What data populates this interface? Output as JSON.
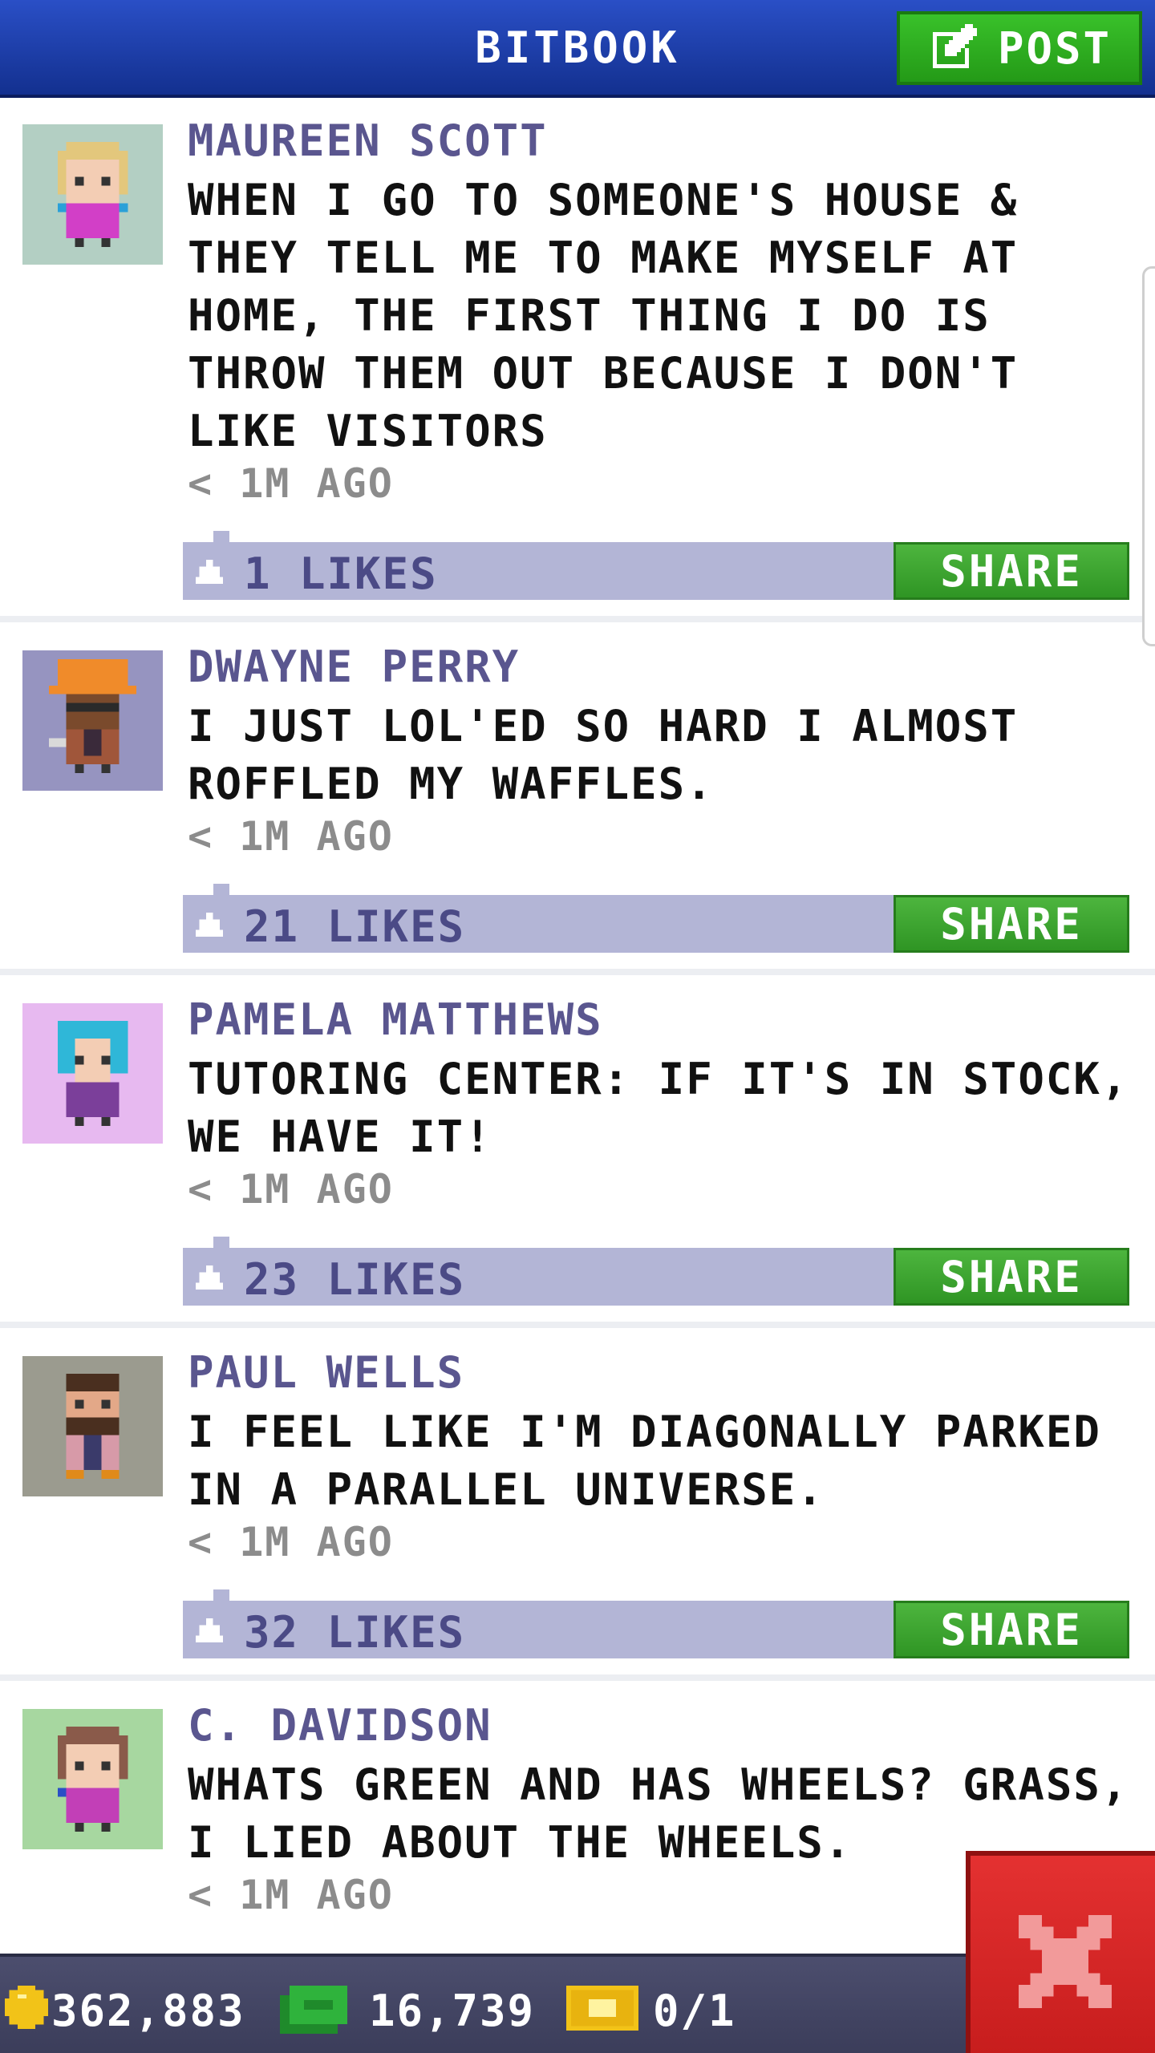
{
  "header": {
    "title": "BITBOOK",
    "post_label": "POST"
  },
  "colors": {
    "header_blue": "#1e3fb0",
    "action_green": "#2f9524",
    "likes_bar": "#b3b5d6",
    "author_purple": "#5a568f",
    "close_red": "#d42626"
  },
  "posts": [
    {
      "author": "MAUREEN SCOTT",
      "text": "WHEN I GO TO SOMEONE'S HOUSE & THEY TELL ME TO MAKE MYSELF AT HOME, THE FIRST THING I DO IS THROW THEM OUT BECAUSE I DON'T LIKE VISITORS",
      "time": "< 1M AGO",
      "likes": "1 LIKES",
      "share_label": "SHARE",
      "avatar_bg": "#b3cfc3"
    },
    {
      "author": "DWAYNE PERRY",
      "text": "I JUST LOL'ED SO HARD I ALMOST ROFFLED MY WAFFLES.",
      "time": "< 1M AGO",
      "likes": "21 LIKES",
      "share_label": "SHARE",
      "avatar_bg": "#9694c0"
    },
    {
      "author": "PAMELA MATTHEWS",
      "text": "TUTORING CENTER: IF IT'S IN STOCK, WE HAVE IT!",
      "time": "< 1M AGO",
      "likes": "23 LIKES",
      "share_label": "SHARE",
      "avatar_bg": "#e7b9f0"
    },
    {
      "author": "PAUL WELLS",
      "text": "I FEEL LIKE I'M DIAGONALLY PARKED IN A PARALLEL UNIVERSE.",
      "time": "< 1M AGO",
      "likes": "32 LIKES",
      "share_label": "SHARE",
      "avatar_bg": "#9b9b8f"
    },
    {
      "author": "C. DAVIDSON",
      "text": "WHATS GREEN AND HAS WHEELS? GRASS, I LIED ABOUT THE WHEELS.",
      "time": "< 1M AGO",
      "avatar_bg": "#a7d7a0"
    }
  ],
  "status_bar": {
    "coins": "362,883",
    "bux": "16,739",
    "tickets": "0/1",
    "coin_icon": "coin-icon",
    "bux_icon": "bux-icon",
    "ticket_icon": "ticket-icon"
  },
  "close_icon": "close-icon"
}
